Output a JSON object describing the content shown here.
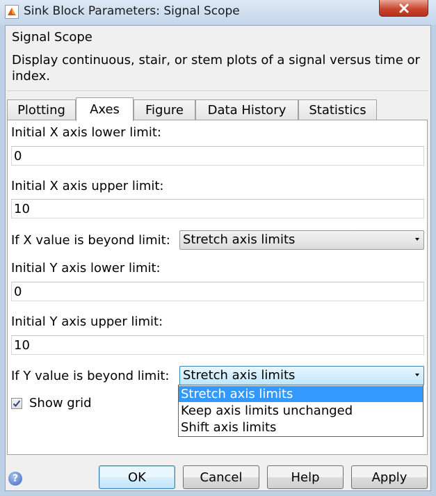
{
  "window": {
    "title": "Sink Block Parameters: Signal Scope"
  },
  "group": {
    "title": "Signal Scope",
    "description": "Display continuous, stair, or stem plots of a signal versus time or index."
  },
  "tabs": [
    {
      "label": "Plotting"
    },
    {
      "label": "Axes"
    },
    {
      "label": "Figure"
    },
    {
      "label": "Data History"
    },
    {
      "label": "Statistics"
    }
  ],
  "axes": {
    "x_lower_label": "Initial X axis lower limit:",
    "x_lower_value": "0",
    "x_upper_label": "Initial X axis upper limit:",
    "x_upper_value": "10",
    "x_beyond_label": "If X value is beyond limit:",
    "x_beyond_value": "Stretch axis limits",
    "y_lower_label": "Initial Y axis lower limit:",
    "y_lower_value": "0",
    "y_upper_label": "Initial Y axis upper limit:",
    "y_upper_value": "10",
    "y_beyond_label": "If Y value is beyond limit:",
    "y_beyond_value": "Stretch axis limits",
    "show_grid_label": "Show grid",
    "show_grid_checked": true
  },
  "dropdown_options": [
    "Stretch axis limits",
    "Keep axis limits unchanged",
    "Shift axis limits"
  ],
  "buttons": {
    "ok": "OK",
    "cancel": "Cancel",
    "help": "Help",
    "apply": "Apply"
  },
  "colors": {
    "selection": "#3399ff",
    "window_frame": "#bcd0e6",
    "close_button": "#c9472f"
  }
}
